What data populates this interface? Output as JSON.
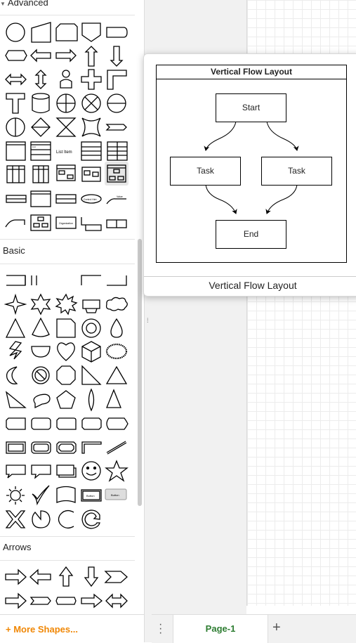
{
  "sidebar": {
    "sections": [
      {
        "label": "Advanced",
        "collapsed": false
      },
      {
        "label": "Basic",
        "collapsed": false
      },
      {
        "label": "Arrows",
        "collapsed": false
      }
    ],
    "shape_text": {
      "list_item": "List Item",
      "list_title": "List",
      "list_item_small": "Item 1",
      "control_text": "Control Hint",
      "callout_text": "Value",
      "org_text": "Organization",
      "section_text": "Section",
      "button_text": "Button"
    },
    "more_shapes_label": "+ More Shapes..."
  },
  "preview": {
    "diagram_title": "Vertical Flow Layout",
    "nodes": {
      "start": "Start",
      "task_left": "Task",
      "task_right": "Task",
      "end": "End"
    },
    "caption": "Vertical Flow Layout"
  },
  "footer": {
    "menu_icon": "vertical-dots-icon",
    "page_tab": "Page-1",
    "add_page_icon": "plus-icon"
  },
  "colors": {
    "accent": "#f08705",
    "page_tab": "#2e7d32"
  }
}
